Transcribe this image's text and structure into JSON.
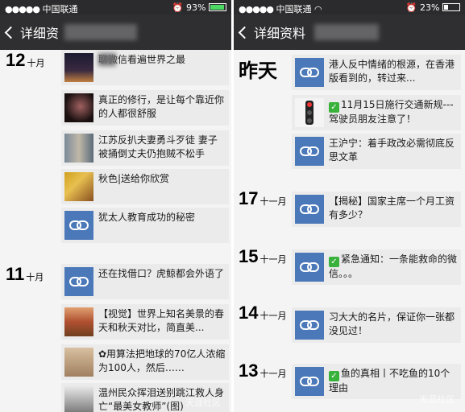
{
  "left": {
    "status": {
      "dots": "●●●●●",
      "carrier": "中国联通",
      "signal": "◔",
      "battery": "93%"
    },
    "nav": {
      "back_label": "详细资"
    },
    "dates": [
      {
        "day": "12",
        "month": "十月"
      },
      {
        "day": "11",
        "month": "十月"
      }
    ],
    "items": [
      {
        "text": "聊微信看遍世界之最",
        "thumb": "city"
      },
      {
        "text": "真正的修行，是让每个靠近你的人都很舒服",
        "thumb": "photo-dark"
      },
      {
        "text": "江苏反扒夫妻勇斗歹徒 妻子被捅倒丈夫仍抱贼不松手",
        "thumb": "photo-street"
      },
      {
        "text": "秋色|送给你欣赏",
        "thumb": "photo-autumn"
      },
      {
        "text": "犹太人教育成功的秘密",
        "thumb": "link"
      },
      {
        "text": "还在找借口？虎鲸都会外语了",
        "thumb": "link"
      },
      {
        "text": "【视觉】世界上知名美景的春天和秋天对比，简直美...",
        "thumb": "photo-landscape"
      },
      {
        "text": "✿用算法把地球的70亿人浓缩为100人，然后……",
        "thumb": "photo-people"
      },
      {
        "text": "温州民众挥泪送别跳江救人身亡“最美女教师”(图)",
        "thumb": "photo-crowd"
      }
    ],
    "watermark": "天涯社区"
  },
  "right": {
    "status": {
      "dots": "●●●●●",
      "carrier": "中国联通",
      "wifi": "wifi",
      "battery": "23%"
    },
    "nav": {
      "back_label": "详细资料"
    },
    "dates": [
      {
        "label": "昨天"
      },
      {
        "day": "17",
        "month": "十一月"
      },
      {
        "day": "15",
        "month": "十一月"
      },
      {
        "day": "14",
        "month": "十一月"
      },
      {
        "day": "13",
        "month": "十一月"
      }
    ],
    "items": [
      {
        "text": "港人反中情绪的根源，在香港版看到的，转过来...",
        "thumb": "link"
      },
      {
        "check": "✓",
        "text": "11月15日施行交通新规---驾驶员朋友注意了！",
        "thumb": "traffic-light"
      },
      {
        "text": "王沪宁：着手政改必需彻底反思文革",
        "thumb": "link"
      },
      {
        "text": "【揭秘】国家主席一个月工资有多少？",
        "thumb": "link"
      },
      {
        "check": "✓",
        "text": "紧急通知：一条能救命的微信。。。",
        "thumb": "link"
      },
      {
        "text": "习大大的名片，保证你一张都没见过！",
        "thumb": "link"
      },
      {
        "check": "✓",
        "text": "鱼的真相丨不吃鱼的10个理由",
        "thumb": "link"
      }
    ],
    "watermark": "天涯社区"
  },
  "colors": {
    "link_icon": "#4a78b8",
    "nav_bg": "#2f2f31",
    "item_bg": "#ebebeb",
    "check": "#38b23a"
  }
}
